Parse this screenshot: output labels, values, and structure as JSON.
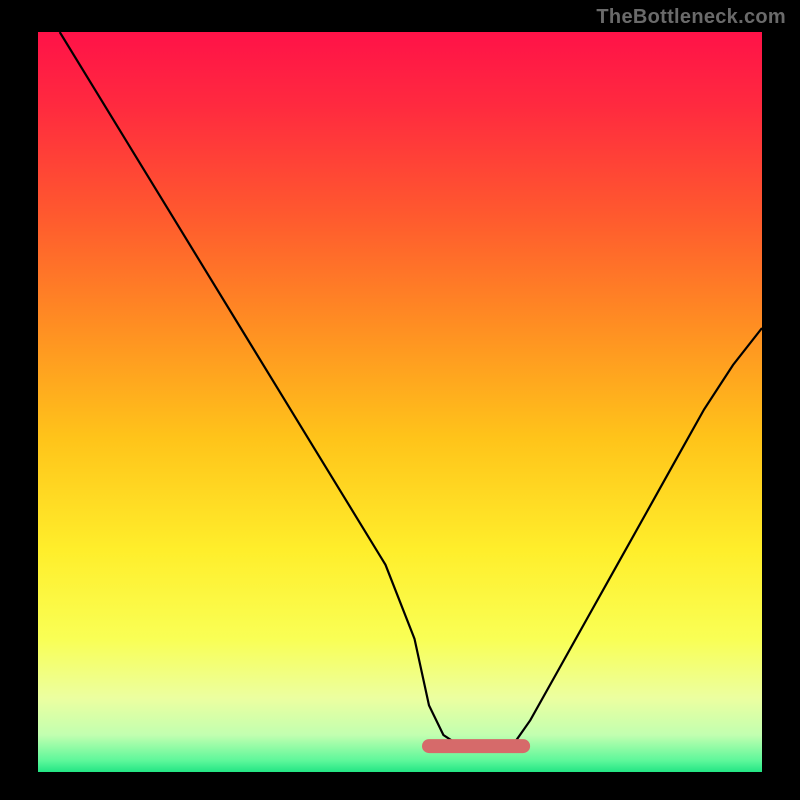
{
  "watermark": "TheBottleneck.com",
  "colors": {
    "frame_bg": "#000000",
    "watermark_text": "#6a6a6a",
    "curve_stroke": "#000000",
    "bottom_band": "#d66a6a",
    "gradient_stops": [
      {
        "offset": 0.0,
        "color": "#ff1248"
      },
      {
        "offset": 0.1,
        "color": "#ff2a3f"
      },
      {
        "offset": 0.25,
        "color": "#ff5a2e"
      },
      {
        "offset": 0.4,
        "color": "#ff8f22"
      },
      {
        "offset": 0.55,
        "color": "#ffc41a"
      },
      {
        "offset": 0.7,
        "color": "#ffee2b"
      },
      {
        "offset": 0.82,
        "color": "#f9ff55"
      },
      {
        "offset": 0.9,
        "color": "#ecffa0"
      },
      {
        "offset": 0.95,
        "color": "#c2ffb0"
      },
      {
        "offset": 0.985,
        "color": "#5cf79a"
      },
      {
        "offset": 1.0,
        "color": "#23e584"
      }
    ]
  },
  "chart_data": {
    "type": "line",
    "title": "",
    "xlabel": "",
    "ylabel": "",
    "xlim": [
      0,
      100
    ],
    "ylim": [
      0,
      100
    ],
    "optimal_band": {
      "x_start": 54,
      "x_end": 67,
      "y": 3.5
    },
    "series": [
      {
        "name": "bottleneck-curve",
        "x": [
          3,
          8,
          13,
          18,
          23,
          28,
          33,
          38,
          43,
          48,
          52,
          54,
          56,
          58,
          60,
          62,
          64,
          66,
          68,
          72,
          76,
          80,
          84,
          88,
          92,
          96,
          100
        ],
        "y": [
          100,
          92,
          84,
          76,
          68,
          60,
          52,
          44,
          36,
          28,
          18,
          9,
          5,
          3.7,
          3.5,
          3.5,
          3.6,
          4.2,
          7,
          14,
          21,
          28,
          35,
          42,
          49,
          55,
          60
        ]
      }
    ]
  }
}
